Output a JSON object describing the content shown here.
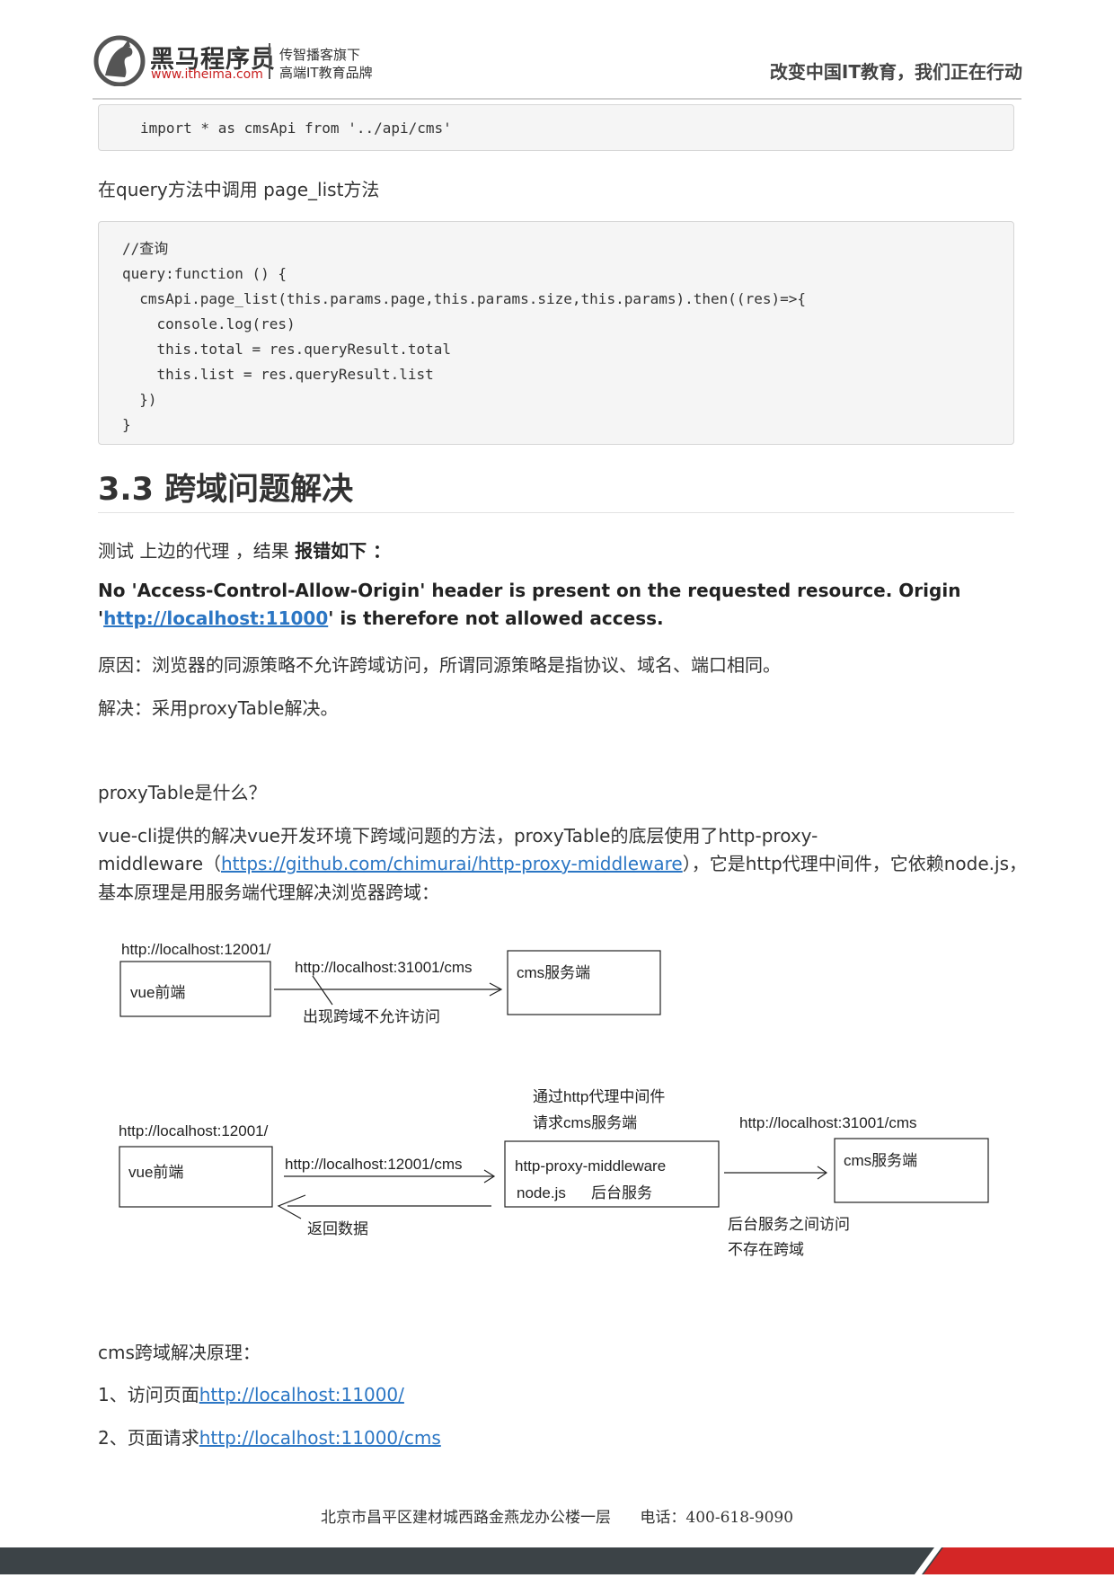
{
  "header": {
    "brand_cn": "黑马程序员",
    "brand_url": "www.itheima.com",
    "tagline_1": "传智播客旗下",
    "tagline_2": "高端IT教育品牌",
    "slogan": "改变中国IT教育，我们正在行动"
  },
  "code_import": [
    "import * as cmsApi from '../api/cms'"
  ],
  "intro_line": "在query方法中调用 page_list方法",
  "code_query": [
    "//查询",
    "query:function () {",
    "  cmsApi.page_list(this.params.page,this.params.size,this.params).then((res)=>{",
    "    console.log(res)",
    "    this.total = res.queryResult.total",
    "    this.list = res.queryResult.list",
    "  })",
    "}"
  ],
  "section": {
    "title": "3.3 跨域问题解决",
    "test_prefix": "测试 上边的代理 ，结果 ",
    "test_bold": "报错如下 ：",
    "error_line1": "No 'Access-Control-Allow-Origin' header is present on the requested resource. Origin",
    "error_quote_open": "'",
    "error_link": "http://localhost:11000",
    "error_line2_rest": "' is therefore not allowed access.",
    "reason": "原因：浏览器的同源策略不允许跨域访问，所谓同源策略是指协议、域名、端口相同。",
    "solution": "解决：采用proxyTable解决。",
    "what_is": "proxyTable是什么？",
    "desc_line1": "vue-cli提供的解决vue开发环境下跨域问题的方法，proxyTable的底层使用了http-proxy-",
    "desc_line2_prefix": "middleware（",
    "desc_link": "https://github.com/chimurai/http-proxy-middleware",
    "desc_line2_suffix": "），它是http代理中间件，它依赖node.js，",
    "desc_line3": "基本原理是用服务端代理解决浏览器跨域："
  },
  "diagram": {
    "top": {
      "client_url": "http://localhost:12001/",
      "client_label": "vue前端",
      "request_url": "http://localhost:31001/cms",
      "blocked_note": "出现跨域不允许访问",
      "server_label": "cms服务端"
    },
    "bottom": {
      "proxy_note_1": "通过http代理中间件",
      "proxy_note_2": "请求cms服务端",
      "client_url": "http://localhost:12001/",
      "client_label": "vue前端",
      "request_url": "http://localhost:12001/cms",
      "proxy_label_1": "http-proxy-middleware",
      "proxy_label_2": "node.js",
      "proxy_label_3": "后台服务",
      "server_url": "http://localhost:31001/cms",
      "server_label": "cms服务端",
      "return_note": "返回数据",
      "backend_note_1": "后台服务之间访问",
      "backend_note_2": "不存在跨域"
    }
  },
  "principle": {
    "title": "cms跨域解决原理：",
    "step1_prefix": "1、访问页面",
    "step1_link": "http://localhost:11000/",
    "step2_prefix": "2、页面请求",
    "step2_link": "http://localhost:11000/cms"
  },
  "footer": {
    "address": "北京市昌平区建材城西路金燕龙办公楼一层",
    "phone": "电话：400-618-9090"
  },
  "colors": {
    "link": "#2b76c4",
    "brand_red": "#c81e1e",
    "footer_dark": "#3c4347"
  }
}
